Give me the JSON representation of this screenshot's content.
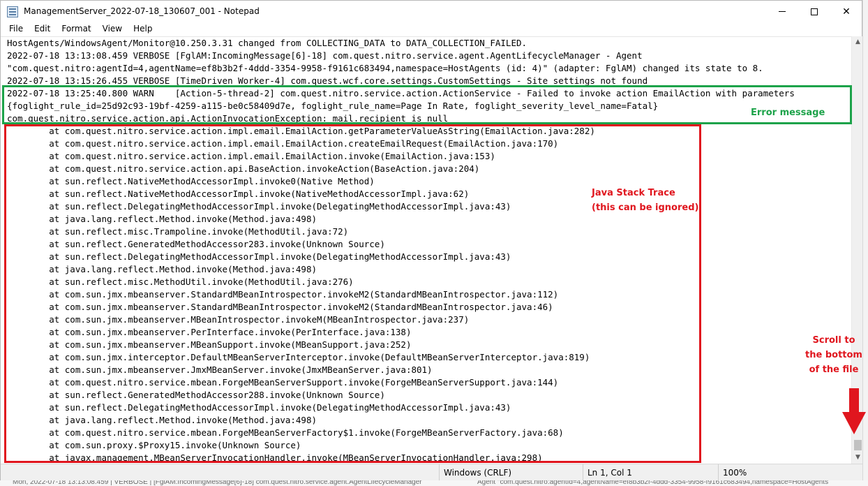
{
  "window": {
    "title": "ManagementServer_2022-07-18_130607_001 - Notepad",
    "controls": {
      "minimize": "—",
      "maximize": "☐",
      "close": "✕"
    }
  },
  "menu": [
    "File",
    "Edit",
    "Format",
    "View",
    "Help"
  ],
  "editor": {
    "lines": [
      "HostAgents/WindowsAgent/Monitor@10.250.3.31 changed from COLLECTING_DATA to DATA_COLLECTION_FAILED.",
      "2022-07-18 13:13:08.459 VERBOSE [FglAM:IncomingMessage[6]-18] com.quest.nitro.service.agent.AgentLifecycleManager - Agent",
      "\"com.quest.nitro:agentId=4,agentName=ef8b3b2f-4ddd-3354-9958-f9161c683494,namespace=HostAgents (id: 4)\" (adapter: FglAM) changed its state to 8.",
      "2022-07-18 13:15:26.455 VERBOSE [TimeDriven Worker-4] com.quest.wcf.core.settings.CustomSettings - Site settings not found",
      "2022-07-18 13:25:40.800 WARN    [Action-5-thread-2] com.quest.nitro.service.action.ActionService - Failed to invoke action EmailAction with parameters",
      "{foglight_rule_id=25d92c93-19bf-4259-a115-be0c58409d7e, foglight_rule_name=Page In Rate, foglight_severity_level_name=Fatal}",
      "com.quest.nitro.service.action.api.ActionInvocationException: mail.recipient is null",
      "        at com.quest.nitro.service.action.impl.email.EmailAction.getParameterValueAsString(EmailAction.java:282)",
      "        at com.quest.nitro.service.action.impl.email.EmailAction.createEmailRequest(EmailAction.java:170)",
      "        at com.quest.nitro.service.action.impl.email.EmailAction.invoke(EmailAction.java:153)",
      "        at com.quest.nitro.service.action.api.BaseAction.invokeAction(BaseAction.java:204)",
      "        at sun.reflect.NativeMethodAccessorImpl.invoke0(Native Method)",
      "        at sun.reflect.NativeMethodAccessorImpl.invoke(NativeMethodAccessorImpl.java:62)",
      "        at sun.reflect.DelegatingMethodAccessorImpl.invoke(DelegatingMethodAccessorImpl.java:43)",
      "        at java.lang.reflect.Method.invoke(Method.java:498)",
      "        at sun.reflect.misc.Trampoline.invoke(MethodUtil.java:72)",
      "        at sun.reflect.GeneratedMethodAccessor283.invoke(Unknown Source)",
      "        at sun.reflect.DelegatingMethodAccessorImpl.invoke(DelegatingMethodAccessorImpl.java:43)",
      "        at java.lang.reflect.Method.invoke(Method.java:498)",
      "        at sun.reflect.misc.MethodUtil.invoke(MethodUtil.java:276)",
      "        at com.sun.jmx.mbeanserver.StandardMBeanIntrospector.invokeM2(StandardMBeanIntrospector.java:112)",
      "        at com.sun.jmx.mbeanserver.StandardMBeanIntrospector.invokeM2(StandardMBeanIntrospector.java:46)",
      "        at com.sun.jmx.mbeanserver.MBeanIntrospector.invokeM(MBeanIntrospector.java:237)",
      "        at com.sun.jmx.mbeanserver.PerInterface.invoke(PerInterface.java:138)",
      "        at com.sun.jmx.mbeanserver.MBeanSupport.invoke(MBeanSupport.java:252)",
      "        at com.sun.jmx.interceptor.DefaultMBeanServerInterceptor.invoke(DefaultMBeanServerInterceptor.java:819)",
      "        at com.sun.jmx.mbeanserver.JmxMBeanServer.invoke(JmxMBeanServer.java:801)",
      "        at com.quest.nitro.service.mbean.ForgeMBeanServerSupport.invoke(ForgeMBeanServerSupport.java:144)",
      "        at sun.reflect.GeneratedMethodAccessor288.invoke(Unknown Source)",
      "        at sun.reflect.DelegatingMethodAccessorImpl.invoke(DelegatingMethodAccessorImpl.java:43)",
      "        at java.lang.reflect.Method.invoke(Method.java:498)",
      "        at com.quest.nitro.service.mbean.ForgeMBeanServerFactory$1.invoke(ForgeMBeanServerFactory.java:68)",
      "        at com.sun.proxy.$Proxy15.invoke(Unknown Source)",
      "        at javax.management.MBeanServerInvocationHandler.invoke(MBeanServerInvocationHandler.java:298)"
    ]
  },
  "scrollbar": {
    "up": "▲",
    "down": "▼"
  },
  "status": {
    "line_ending": "Windows (CRLF)",
    "position": "Ln 1, Col 1",
    "zoom": "100%"
  },
  "annotations": {
    "error_message": "Error message",
    "stack_trace_line1": "Java Stack Trace",
    "stack_trace_line2": "(this can be ignored)",
    "scroll_line1": "Scroll to",
    "scroll_line2": "the bottom",
    "scroll_line3": "of the file",
    "colors": {
      "green": "#1da34a",
      "red": "#e0161e"
    }
  },
  "background": {
    "bottom_text_left": "Mon, 2022-07-18 13:13:08.459 | VERBOSE | [FglAM:IncomingMessage[6]-18] com.quest.nitro.service.agent.AgentLifecycleManager",
    "bottom_text_right": "Agent \"com.quest.nitro:agentId=4,agentName=ef8b3b2f-4ddd-3354-9958-f9161c683494,namespace=HostAgents"
  }
}
